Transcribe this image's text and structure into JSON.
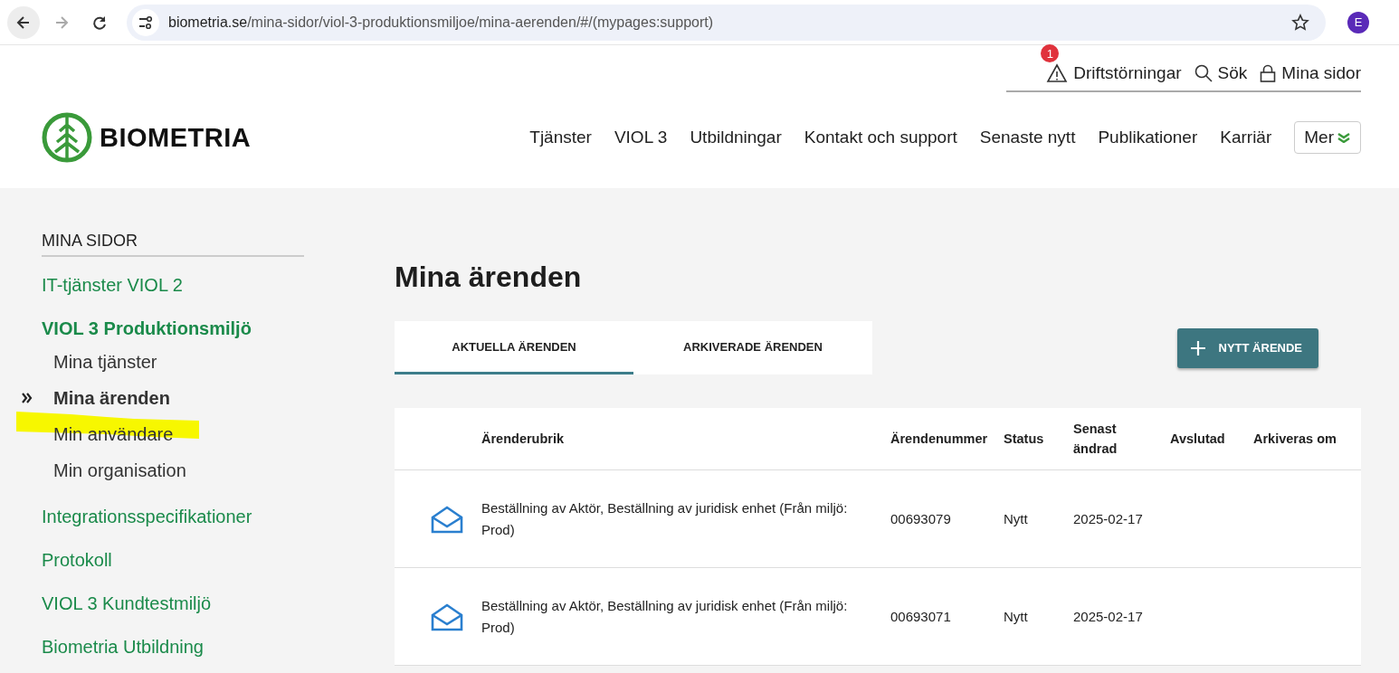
{
  "browser": {
    "url_host": "biometria.se",
    "url_path": "/mina-sidor/viol-3-produktionsmiljoe/mina-aerenden/#/(mypages:support)",
    "profile_initial": "E"
  },
  "header": {
    "logo": "BIOMETRIA",
    "top_links": [
      {
        "kind": "alerts",
        "label": "Driftstörningar",
        "badge": "1"
      },
      {
        "kind": "search",
        "label": "Sök"
      },
      {
        "kind": "account",
        "label": "Mina sidor"
      }
    ],
    "nav": [
      "Tjänster",
      "VIOL 3",
      "Utbildningar",
      "Kontakt och support",
      "Senaste nytt",
      "Publikationer",
      "Karriär"
    ],
    "more_button": "Mer"
  },
  "sidebar": {
    "heading": "MINA SIDOR",
    "items": [
      {
        "label": "IT-tjänster VIOL 2",
        "expanded": false
      },
      {
        "label": "VIOL 3 Produktionsmiljö",
        "expanded": true,
        "children": [
          {
            "label": "Mina tjänster",
            "selected": false
          },
          {
            "label": "Mina ärenden",
            "selected": true
          },
          {
            "label": "Min användare",
            "selected": false
          },
          {
            "label": "Min organisation",
            "selected": false
          }
        ]
      },
      {
        "label": "Integrationsspecifikationer",
        "expanded": false
      },
      {
        "label": "Protokoll",
        "expanded": false
      },
      {
        "label": "VIOL 3 Kundtestmiljö",
        "expanded": false
      },
      {
        "label": "Biometria Utbildning",
        "expanded": false
      }
    ]
  },
  "page_title": "Mina ärenden",
  "tabs": [
    {
      "label": "AKTUELLA ÄRENDEN",
      "selected": true
    },
    {
      "label": "ARKIVERADE ÄRENDEN",
      "selected": false
    }
  ],
  "new_button": "NYTT ÄRENDE",
  "table": {
    "columns": [
      "Ärenderubrik",
      "Ärendenummer",
      "Status",
      "Senast ändrad",
      "Avslutad",
      "Arkiveras om"
    ],
    "rows": [
      {
        "title": "Beställning av Aktör, Beställning av juridisk enhet (Från miljö: Prod)",
        "number": "00693079",
        "status": "Nytt",
        "changed": "2025-02-17"
      },
      {
        "title": "Beställning av Aktör, Beställning av juridisk enhet (Från miljö: Prod)",
        "number": "00693071",
        "status": "Nytt",
        "changed": "2025-02-17"
      }
    ]
  }
}
